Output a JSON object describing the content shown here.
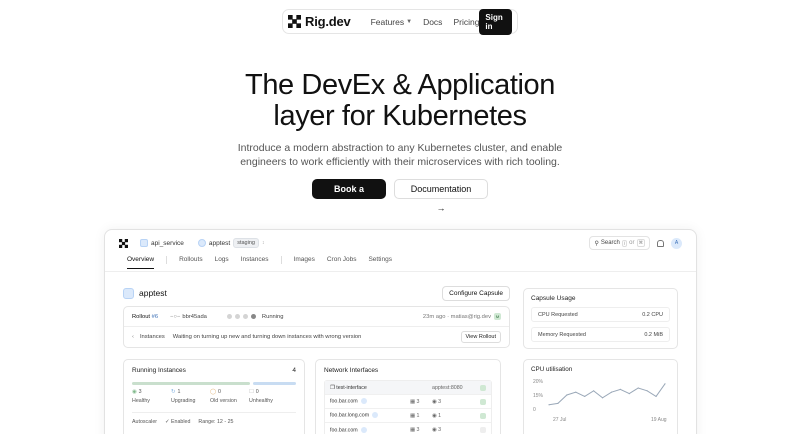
{
  "nav": {
    "brand": "Rig.dev",
    "links": [
      "Features",
      "Docs",
      "Pricing"
    ],
    "signin": "Sign in"
  },
  "hero": {
    "title_line1": "The DevEx & Application",
    "title_line2": "layer for Kubernetes",
    "sub_line1": "Introduce a modern abstraction to any Kubernetes cluster, and enable",
    "sub_line2": "engineers to work efficiently with their microservices with rich tooling.",
    "primary_cta": "Book a demo",
    "secondary_cta": "Documentation →"
  },
  "app": {
    "project": "api_service",
    "env_name": "apptest",
    "env_badge": "staging",
    "search_label": "Search",
    "search_key1": "/",
    "search_or": "or",
    "search_key2": "⌘",
    "avatar": "A",
    "tabs": [
      "Overview",
      "Rollouts",
      "Logs",
      "Instances",
      "Images",
      "Cron Jobs",
      "Settings"
    ],
    "capsule_name": "apptest",
    "configure_btn": "Configure Capsule",
    "rollout": {
      "label": "Rollout",
      "number": "#6",
      "commit": "bbr45ada",
      "state": "Running",
      "meta": "23m ago · matias@rig.dev",
      "user_initial": "M",
      "instances_label": "Instances",
      "message": "Waiting on turning up new and turning down instances with wrong version",
      "view_btn": "View Rollout"
    },
    "running": {
      "title": "Running Instances",
      "count": "4",
      "stats": [
        {
          "value": "3",
          "label": "Healthy",
          "color": "#7fb88a"
        },
        {
          "value": "1",
          "label": "Upgrading",
          "color": "#7fb0e0"
        },
        {
          "value": "0",
          "label": "Old version",
          "color": "#e0b070"
        },
        {
          "value": "0",
          "label": "Unhealthy",
          "color": "#cccccc"
        }
      ],
      "autoscaler": "Autoscaler",
      "autoscaler_state": "Enabled",
      "range": "Range: 12 - 25"
    },
    "network": {
      "title": "Network Interfaces",
      "rows": [
        {
          "name": "test-interface",
          "ports": "",
          "target": "apptest:8080"
        },
        {
          "name": "foo.bar.com",
          "ports": "3",
          "target": "3"
        },
        {
          "name": "foo.bar.long.com",
          "ports": "1",
          "target": "1"
        },
        {
          "name": "foo.bar.com",
          "ports": "3",
          "target": "3"
        }
      ]
    },
    "usage": {
      "title": "Capsule Usage",
      "cpu_label": "CPU Requested",
      "cpu_value": "0.2 CPU",
      "mem_label": "Memory Requested",
      "mem_value": "0.2 MiB"
    },
    "cpu_chart": {
      "title": "CPU utilisation",
      "y_ticks": [
        "20%",
        "15%",
        "0"
      ],
      "x_ticks": [
        "27 Jul",
        "19 Aug"
      ]
    }
  },
  "chart_data": {
    "type": "line",
    "title": "CPU utilisation",
    "x_tick_labels": [
      "27 Jul",
      "19 Aug"
    ],
    "values": [
      3,
      4,
      10,
      12,
      9,
      13,
      8,
      12,
      14,
      11,
      15,
      13,
      9,
      18
    ],
    "ylim": [
      0,
      20
    ],
    "y_tick_labels": [
      "20%",
      "15%",
      "0"
    ]
  },
  "colors": {
    "accent": "#3b6fb6",
    "dark": "#111111"
  }
}
